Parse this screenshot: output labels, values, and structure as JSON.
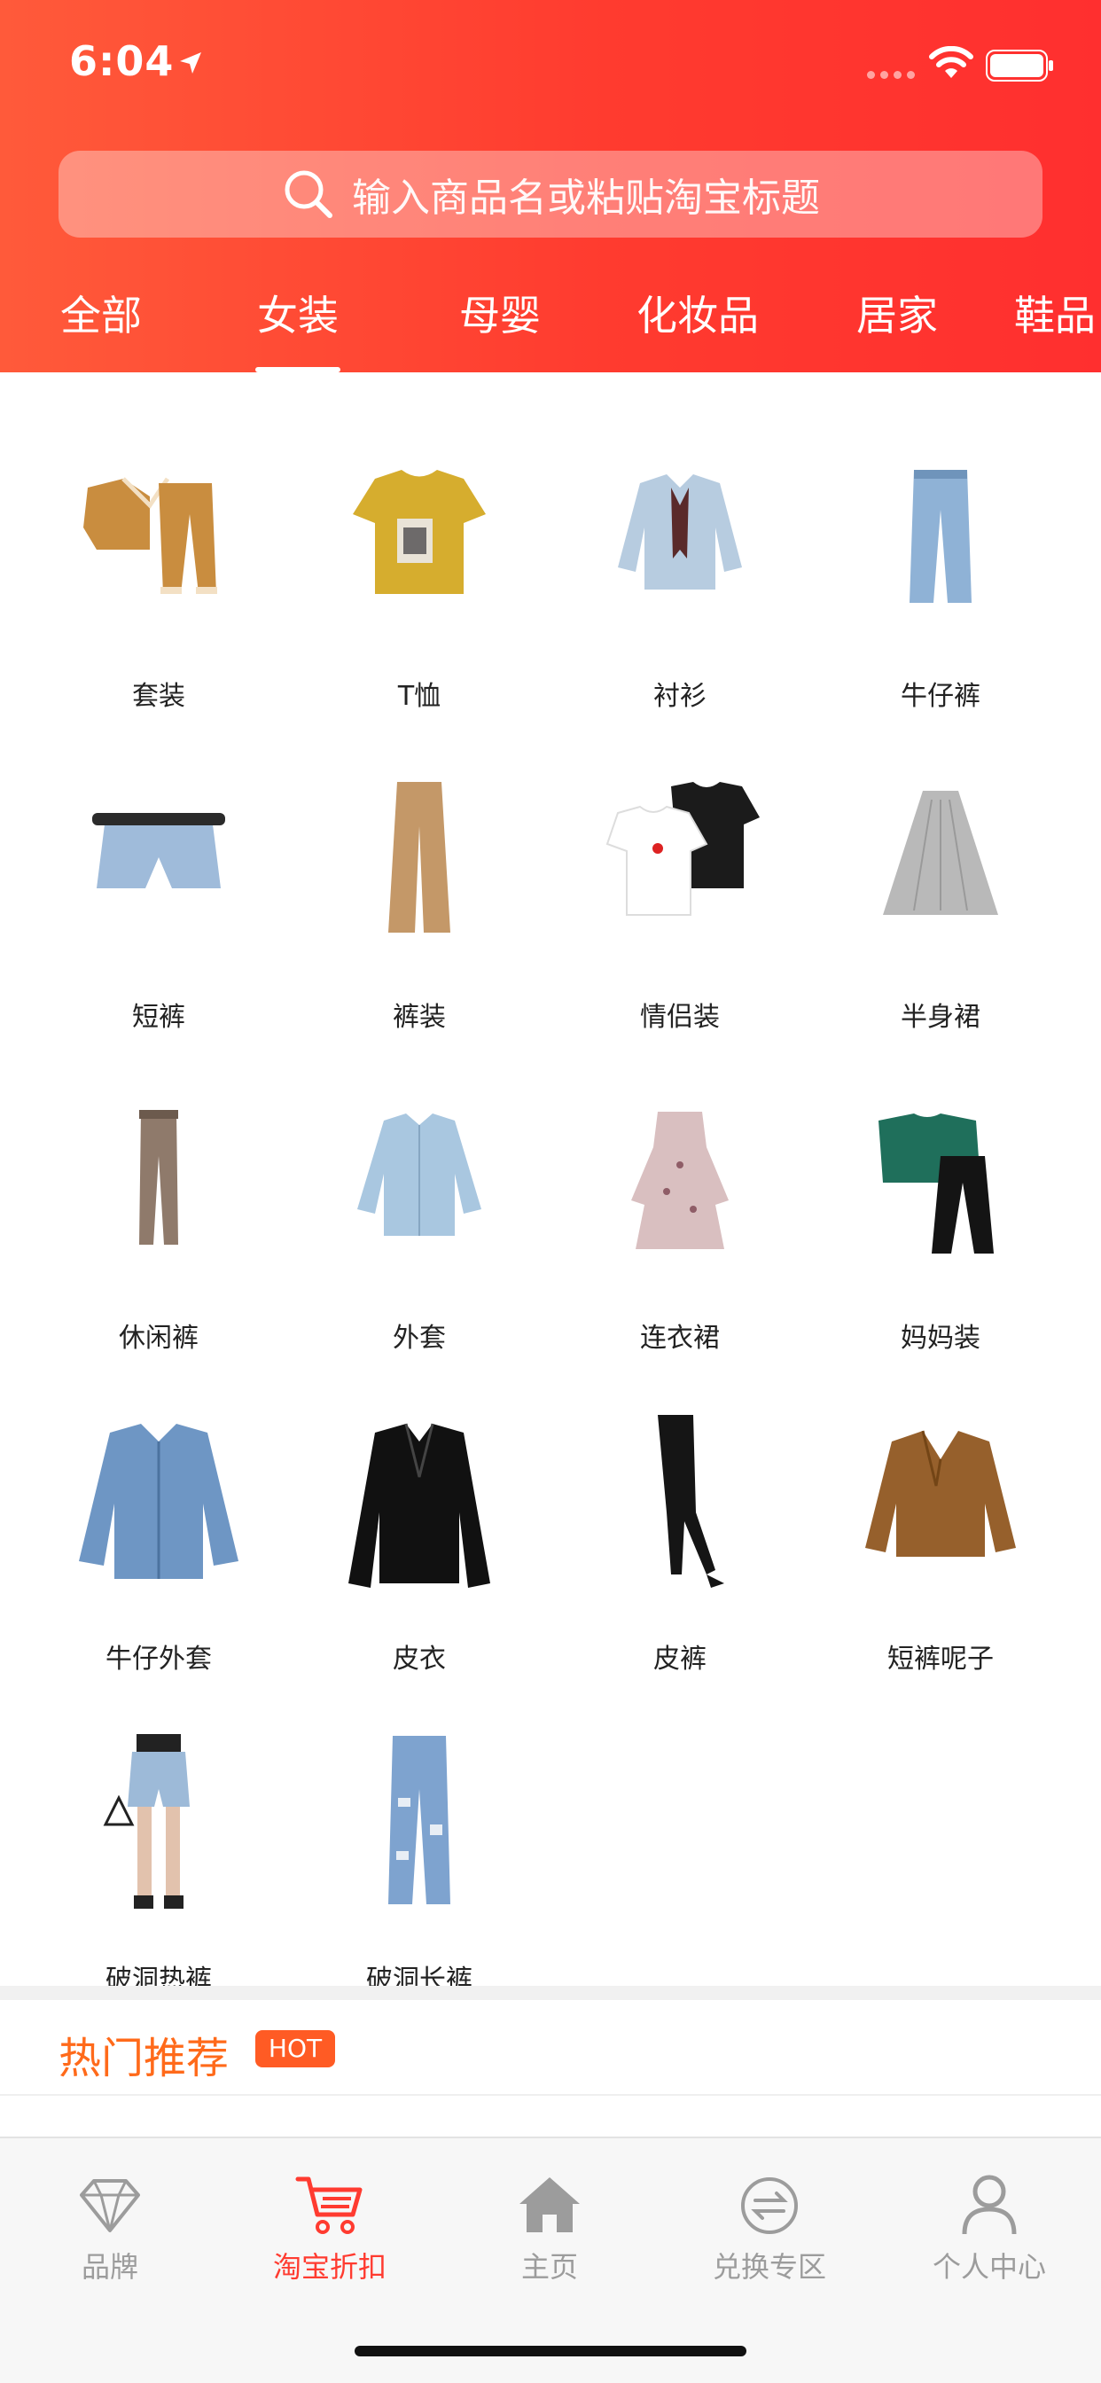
{
  "status_bar": {
    "time": "6:04"
  },
  "search": {
    "placeholder": "输入商品名或粘贴淘宝标题"
  },
  "category_tabs": [
    {
      "label": "全部"
    },
    {
      "label": "女装",
      "active": true
    },
    {
      "label": "母婴"
    },
    {
      "label": "化妆品"
    },
    {
      "label": "居家"
    },
    {
      "label": "鞋品"
    }
  ],
  "subcategories": [
    {
      "label": "套装",
      "icon": "tracksuit-image"
    },
    {
      "label": "T恤",
      "icon": "tshirt-image"
    },
    {
      "label": "衬衫",
      "icon": "shirt-image"
    },
    {
      "label": "牛仔裤",
      "icon": "jeans-image"
    },
    {
      "label": "短裤",
      "icon": "denim-shorts-image"
    },
    {
      "label": "裤装",
      "icon": "wide-pants-image"
    },
    {
      "label": "情侣装",
      "icon": "couple-tees-image"
    },
    {
      "label": "半身裙",
      "icon": "pleated-skirt-image"
    },
    {
      "label": "休闲裤",
      "icon": "casual-pants-image"
    },
    {
      "label": "外套",
      "icon": "light-jacket-image"
    },
    {
      "label": "连衣裙",
      "icon": "floral-dress-image"
    },
    {
      "label": "妈妈装",
      "icon": "mom-outfit-image"
    },
    {
      "label": "牛仔外套",
      "icon": "denim-jacket-image"
    },
    {
      "label": "皮衣",
      "icon": "leather-jacket-image"
    },
    {
      "label": "皮裤",
      "icon": "leather-pants-image"
    },
    {
      "label": "短裤呢子",
      "icon": "wool-coat-image"
    },
    {
      "label": "破洞热裤",
      "icon": "ripped-shorts-image"
    },
    {
      "label": "破洞长裤",
      "icon": "ripped-jeans-image"
    }
  ],
  "hot_section": {
    "title": "热门推荐",
    "badge": "HOT"
  },
  "bottom_tabs": [
    {
      "label": "品牌",
      "icon": "diamond-icon"
    },
    {
      "label": "淘宝折扣",
      "icon": "cart-icon",
      "active": true
    },
    {
      "label": "主页",
      "icon": "home-icon"
    },
    {
      "label": "兑换专区",
      "icon": "exchange-icon"
    },
    {
      "label": "个人中心",
      "icon": "person-icon"
    }
  ],
  "colors": {
    "accent": "#ff3b30",
    "header_start": "#ff5a3a",
    "hot_orange": "#ff6a1a"
  }
}
